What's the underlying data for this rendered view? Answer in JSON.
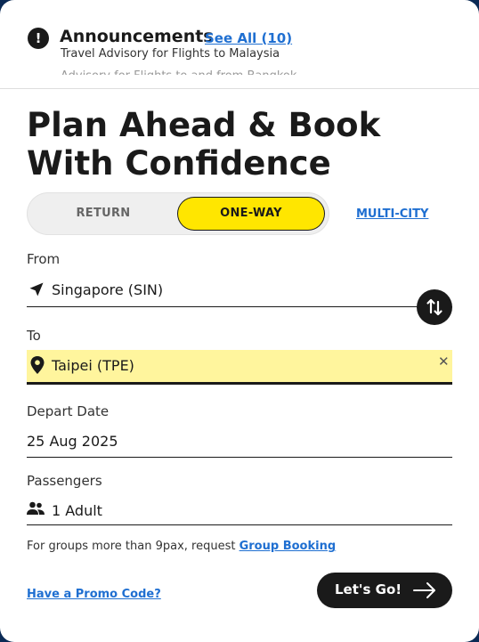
{
  "announcements": {
    "title": "Announcements",
    "see_all": "See All (10)",
    "headline": "Travel Advisory for Flights to Malaysia",
    "next_line": "Advisory for Flights to and from Bangkok"
  },
  "heading": "Plan Ahead & Book With Confidence",
  "trip_type": {
    "options": [
      "RETURN",
      "ONE-WAY"
    ],
    "selected": "ONE-WAY",
    "multi_city": "MULTI-CITY"
  },
  "from": {
    "label": "From",
    "value": "Singapore (SIN)"
  },
  "to": {
    "label": "To",
    "value": "Taipei (TPE)"
  },
  "depart": {
    "label": "Depart Date",
    "value": "25 Aug 2025"
  },
  "passengers": {
    "label": "Passengers",
    "value": "1 Adult"
  },
  "group_note": {
    "text": "For groups more than 9pax, request ",
    "link": "Group Booking"
  },
  "promo_link": "Have a Promo Code?",
  "submit_label": "Let's Go!",
  "colors": {
    "accent": "#ffe600",
    "link": "#1f6fd1",
    "highlight": "#fff59d",
    "dark": "#1a1a1a"
  }
}
